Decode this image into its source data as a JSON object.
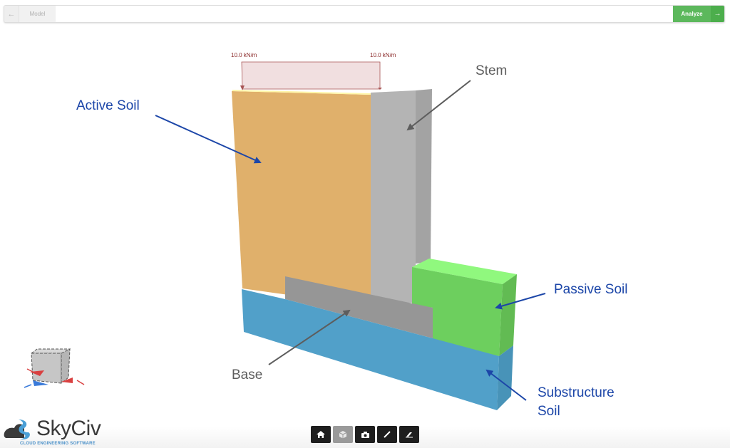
{
  "header": {
    "back_icon": "arrow-left-icon",
    "breadcrumb": "Model",
    "analyze_label": "Analyze",
    "analyze_arrow_icon": "arrow-right-icon"
  },
  "model": {
    "loads": {
      "left_value": "10.0 kN/m",
      "right_value": "10.0 kN/m"
    },
    "annotations": {
      "active_soil": "Active Soil",
      "stem": "Stem",
      "passive_soil": "Passive Soil",
      "base": "Base",
      "substructure_line1": "Substructure",
      "substructure_line2": "Soil"
    },
    "colors": {
      "active_soil": "#e0b06b",
      "stem_front": "#b4b4b4",
      "stem_side": "#a2a2a2",
      "base": "#969696",
      "passive_front": "#6dcf5e",
      "passive_top": "#90f87e",
      "passive_side": "#62bb53",
      "substructure_front": "#51a0c9",
      "substructure_side": "#4893b8",
      "load_fill": "#f1dfe0",
      "load_stroke": "#a85555",
      "annotation_blue": "#1c46a8",
      "annotation_gray": "#5d5d5d"
    }
  },
  "toolbar": {
    "buttons": [
      {
        "icon": "home-icon",
        "active": false
      },
      {
        "icon": "3d-view-icon",
        "active": true
      },
      {
        "icon": "camera-icon",
        "active": false
      },
      {
        "icon": "measure-icon",
        "active": false
      },
      {
        "icon": "eraser-icon",
        "active": false
      }
    ]
  },
  "branding": {
    "logo_name": "SkyCiv",
    "tagline": "CLOUD ENGINEERING SOFTWARE"
  }
}
